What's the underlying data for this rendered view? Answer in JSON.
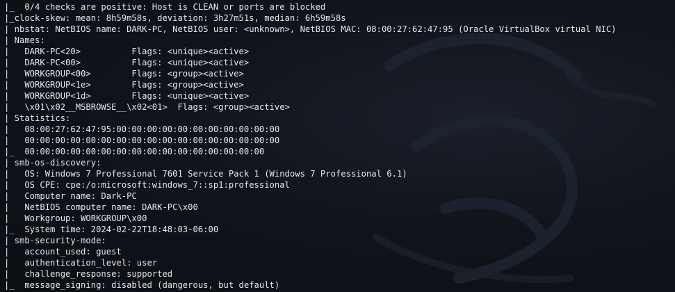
{
  "terminal": {
    "lines": [
      "|_  0/4 checks are positive: Host is CLEAN or ports are blocked",
      "|_clock-skew: mean: 8h59m58s, deviation: 3h27m51s, median: 6h59m58s",
      "| nbstat: NetBIOS name: DARK-PC, NetBIOS user: <unknown>, NetBIOS MAC: 08:00:27:62:47:95 (Oracle VirtualBox virtual NIC)",
      "| Names:",
      "|   DARK-PC<20>          Flags: <unique><active>",
      "|   DARK-PC<00>          Flags: <unique><active>",
      "|   WORKGROUP<00>        Flags: <group><active>",
      "|   WORKGROUP<1e>        Flags: <group><active>",
      "|   WORKGROUP<1d>        Flags: <unique><active>",
      "|   \\x01\\x02__MSBROWSE__\\x02<01>  Flags: <group><active>",
      "| Statistics:",
      "|   08:00:27:62:47:95:00:00:00:00:00:00:00:00:00:00:00",
      "|   00:00:00:00:00:00:00:00:00:00:00:00:00:00:00:00:00",
      "|_  00:00:00:00:00:00:00:00:00:00:00:00:00:00:00:00",
      "| smb-os-discovery:",
      "|   OS: Windows 7 Professional 7601 Service Pack 1 (Windows 7 Professional 6.1)",
      "|   OS CPE: cpe:/o:microsoft:windows_7::sp1:professional",
      "|   Computer name: Dark-PC",
      "|   NetBIOS computer name: DARK-PC\\x00",
      "|   Workgroup: WORKGROUP\\x00",
      "|_  System time: 2024-02-22T18:48:03-06:00",
      "| smb-security-mode:",
      "|   account_used: guest",
      "|   authentication_level: user",
      "|   challenge_response: supported",
      "|_  message_signing: disabled (dangerous, but default)"
    ]
  }
}
